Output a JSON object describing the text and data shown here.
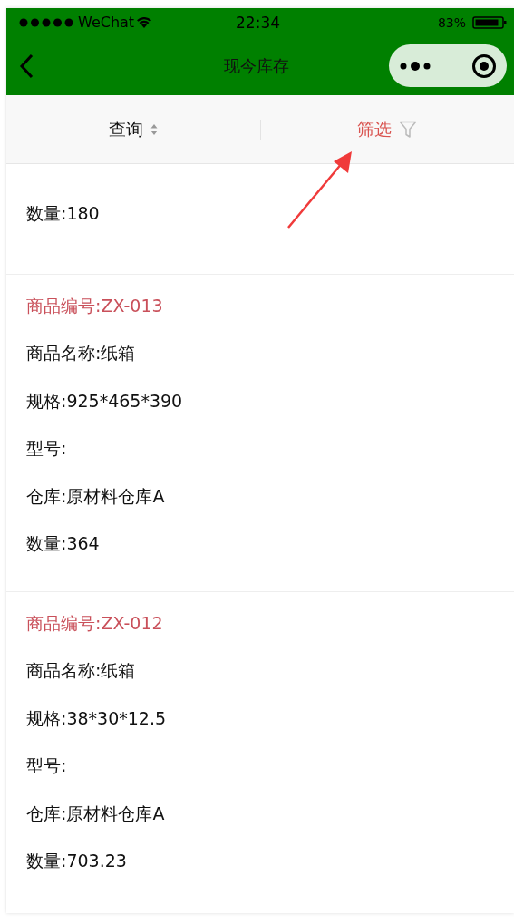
{
  "status_bar": {
    "carrier": "WeChat",
    "time": "22:34",
    "battery": "83%"
  },
  "nav": {
    "title": "现今库存"
  },
  "filter_tabs": [
    {
      "label": "查询",
      "selected": false
    },
    {
      "label": "筛选",
      "selected": true
    }
  ],
  "items": [
    {
      "lines": [
        {
          "kind": "field",
          "text": "数量:180"
        }
      ]
    },
    {
      "lines": [
        {
          "kind": "code",
          "text": "商品编号:ZX-013"
        },
        {
          "kind": "field",
          "text": "商品名称:纸箱"
        },
        {
          "kind": "field",
          "text": "规格:925*465*390"
        },
        {
          "kind": "field",
          "text": "型号:"
        },
        {
          "kind": "field",
          "text": "仓库:原材料仓库A"
        },
        {
          "kind": "field",
          "text": "数量:364"
        }
      ]
    },
    {
      "lines": [
        {
          "kind": "code",
          "text": "商品编号:ZX-012"
        },
        {
          "kind": "field",
          "text": "商品名称:纸箱"
        },
        {
          "kind": "field",
          "text": "规格:38*30*12.5"
        },
        {
          "kind": "field",
          "text": "型号:"
        },
        {
          "kind": "field",
          "text": "仓库:原材料仓库A"
        },
        {
          "kind": "field",
          "text": "数量:703.23"
        }
      ]
    }
  ]
}
